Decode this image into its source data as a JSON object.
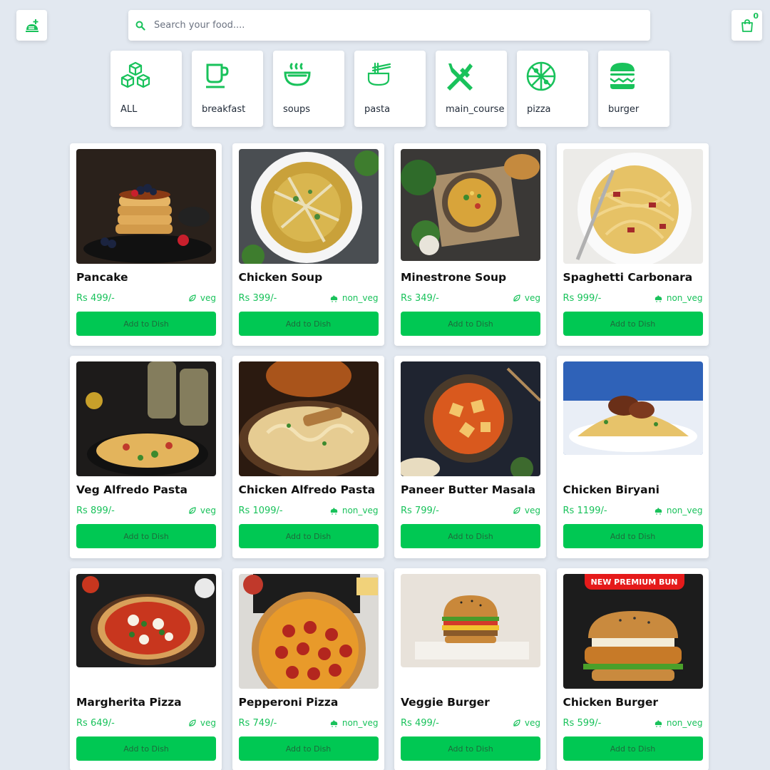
{
  "header": {
    "search_placeholder": "Search your food....",
    "cart_count": "0"
  },
  "categories": [
    {
      "label": "ALL",
      "icon": "cubes-icon"
    },
    {
      "label": "breakfast",
      "icon": "coffee-cup-icon"
    },
    {
      "label": "soups",
      "icon": "soup-bowl-icon"
    },
    {
      "label": "pasta",
      "icon": "noodle-bowl-icon"
    },
    {
      "label": "main_course",
      "icon": "utensils-icon"
    },
    {
      "label": "pizza",
      "icon": "pizza-icon"
    },
    {
      "label": "burger",
      "icon": "burger-icon"
    }
  ],
  "items": [
    {
      "name": "Pancake",
      "price": "Rs 499/-",
      "diet": "veg"
    },
    {
      "name": "Chicken Soup",
      "price": "Rs 399/-",
      "diet": "non_veg"
    },
    {
      "name": "Minestrone Soup",
      "price": "Rs 349/-",
      "diet": "veg"
    },
    {
      "name": "Spaghetti Carbonara",
      "price": "Rs 999/-",
      "diet": "non_veg"
    },
    {
      "name": "Veg Alfredo Pasta",
      "price": "Rs 899/-",
      "diet": "veg"
    },
    {
      "name": "Chicken Alfredo Pasta",
      "price": "Rs 1099/-",
      "diet": "non_veg"
    },
    {
      "name": "Paneer Butter Masala",
      "price": "Rs 799/-",
      "diet": "veg"
    },
    {
      "name": "Chicken Biryani",
      "price": "Rs 1199/-",
      "diet": "non_veg"
    },
    {
      "name": "Margherita Pizza",
      "price": "Rs 649/-",
      "diet": "veg"
    },
    {
      "name": "Pepperoni Pizza",
      "price": "Rs 749/-",
      "diet": "non_veg"
    },
    {
      "name": "Veggie Burger",
      "price": "Rs 499/-",
      "diet": "veg"
    },
    {
      "name": "Chicken Burger",
      "price": "Rs 599/-",
      "diet": "non_veg",
      "promo": "NEW PREMIUM BUN"
    }
  ],
  "add_label": "Add to Dish",
  "colors": {
    "accent": "#19c25b",
    "button": "#00c853",
    "background": "#e2e8f0",
    "promo": "#e51a1a"
  }
}
